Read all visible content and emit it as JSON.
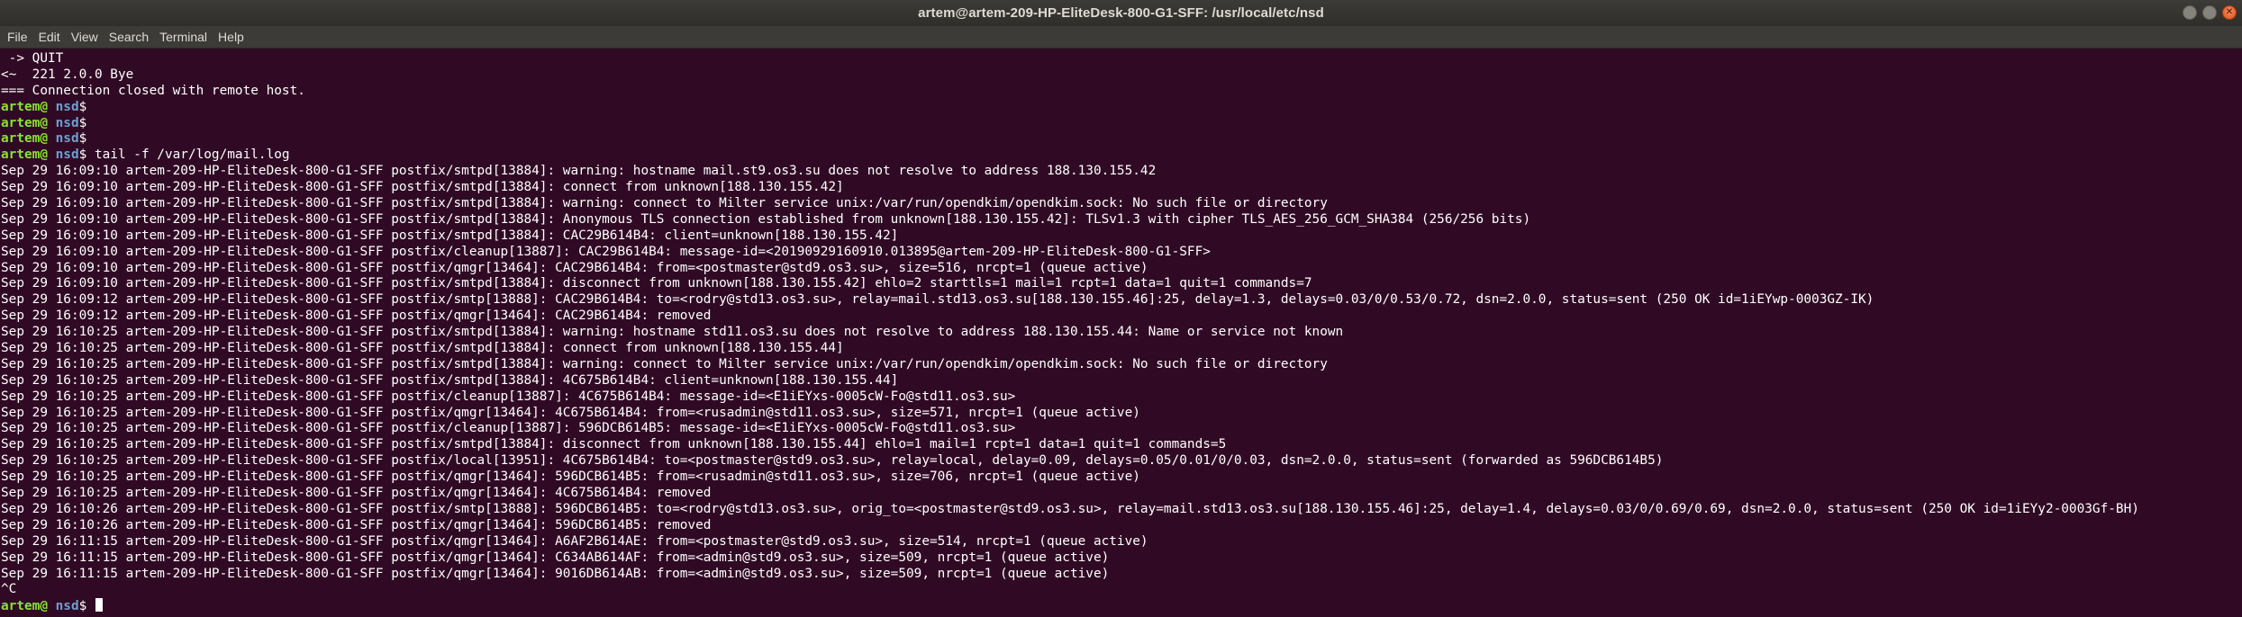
{
  "window": {
    "title": "artem@artem-209-HP-EliteDesk-800-G1-SFF: /usr/local/etc/nsd",
    "controls": {
      "minimize_glyph": "",
      "maximize_glyph": "",
      "close_glyph": "✕"
    }
  },
  "menu": [
    "File",
    "Edit",
    "View",
    "Search",
    "Terminal",
    "Help"
  ],
  "prompt": {
    "user": "artem@",
    "path": " nsd",
    "symbol": "$"
  },
  "colors": {
    "background": "#300a24",
    "prompt_user": "#8ae234",
    "prompt_path": "#729fcf",
    "text": "#ffffff"
  },
  "terminal": {
    "pre_lines": [
      " -> QUIT",
      "<~  221 2.0.0 Bye",
      "=== Connection closed with remote host."
    ],
    "prompt_commands": [
      "",
      "",
      "",
      " tail -f /var/log/mail.log"
    ],
    "log_lines": [
      "Sep 29 16:09:10 artem-209-HP-EliteDesk-800-G1-SFF postfix/smtpd[13884]: warning: hostname mail.st9.os3.su does not resolve to address 188.130.155.42",
      "Sep 29 16:09:10 artem-209-HP-EliteDesk-800-G1-SFF postfix/smtpd[13884]: connect from unknown[188.130.155.42]",
      "Sep 29 16:09:10 artem-209-HP-EliteDesk-800-G1-SFF postfix/smtpd[13884]: warning: connect to Milter service unix:/var/run/opendkim/opendkim.sock: No such file or directory",
      "Sep 29 16:09:10 artem-209-HP-EliteDesk-800-G1-SFF postfix/smtpd[13884]: Anonymous TLS connection established from unknown[188.130.155.42]: TLSv1.3 with cipher TLS_AES_256_GCM_SHA384 (256/256 bits)",
      "Sep 29 16:09:10 artem-209-HP-EliteDesk-800-G1-SFF postfix/smtpd[13884]: CAC29B614B4: client=unknown[188.130.155.42]",
      "Sep 29 16:09:10 artem-209-HP-EliteDesk-800-G1-SFF postfix/cleanup[13887]: CAC29B614B4: message-id=<20190929160910.013895@artem-209-HP-EliteDesk-800-G1-SFF>",
      "Sep 29 16:09:10 artem-209-HP-EliteDesk-800-G1-SFF postfix/qmgr[13464]: CAC29B614B4: from=<postmaster@std9.os3.su>, size=516, nrcpt=1 (queue active)",
      "Sep 29 16:09:10 artem-209-HP-EliteDesk-800-G1-SFF postfix/smtpd[13884]: disconnect from unknown[188.130.155.42] ehlo=2 starttls=1 mail=1 rcpt=1 data=1 quit=1 commands=7",
      "Sep 29 16:09:12 artem-209-HP-EliteDesk-800-G1-SFF postfix/smtp[13888]: CAC29B614B4: to=<rodry@std13.os3.su>, relay=mail.std13.os3.su[188.130.155.46]:25, delay=1.3, delays=0.03/0/0.53/0.72, dsn=2.0.0, status=sent (250 OK id=1iEYwp-0003GZ-IK)",
      "Sep 29 16:09:12 artem-209-HP-EliteDesk-800-G1-SFF postfix/qmgr[13464]: CAC29B614B4: removed",
      "Sep 29 16:10:25 artem-209-HP-EliteDesk-800-G1-SFF postfix/smtpd[13884]: warning: hostname std11.os3.su does not resolve to address 188.130.155.44: Name or service not known",
      "Sep 29 16:10:25 artem-209-HP-EliteDesk-800-G1-SFF postfix/smtpd[13884]: connect from unknown[188.130.155.44]",
      "Sep 29 16:10:25 artem-209-HP-EliteDesk-800-G1-SFF postfix/smtpd[13884]: warning: connect to Milter service unix:/var/run/opendkim/opendkim.sock: No such file or directory",
      "Sep 29 16:10:25 artem-209-HP-EliteDesk-800-G1-SFF postfix/smtpd[13884]: 4C675B614B4: client=unknown[188.130.155.44]",
      "Sep 29 16:10:25 artem-209-HP-EliteDesk-800-G1-SFF postfix/cleanup[13887]: 4C675B614B4: message-id=<E1iEYxs-0005cW-Fo@std11.os3.su>",
      "Sep 29 16:10:25 artem-209-HP-EliteDesk-800-G1-SFF postfix/qmgr[13464]: 4C675B614B4: from=<rusadmin@std11.os3.su>, size=571, nrcpt=1 (queue active)",
      "Sep 29 16:10:25 artem-209-HP-EliteDesk-800-G1-SFF postfix/cleanup[13887]: 596DCB614B5: message-id=<E1iEYxs-0005cW-Fo@std11.os3.su>",
      "Sep 29 16:10:25 artem-209-HP-EliteDesk-800-G1-SFF postfix/smtpd[13884]: disconnect from unknown[188.130.155.44] ehlo=1 mail=1 rcpt=1 data=1 quit=1 commands=5",
      "Sep 29 16:10:25 artem-209-HP-EliteDesk-800-G1-SFF postfix/local[13951]: 4C675B614B4: to=<postmaster@std9.os3.su>, relay=local, delay=0.09, delays=0.05/0.01/0/0.03, dsn=2.0.0, status=sent (forwarded as 596DCB614B5)",
      "Sep 29 16:10:25 artem-209-HP-EliteDesk-800-G1-SFF postfix/qmgr[13464]: 596DCB614B5: from=<rusadmin@std11.os3.su>, size=706, nrcpt=1 (queue active)",
      "Sep 29 16:10:25 artem-209-HP-EliteDesk-800-G1-SFF postfix/qmgr[13464]: 4C675B614B4: removed",
      "Sep 29 16:10:26 artem-209-HP-EliteDesk-800-G1-SFF postfix/smtp[13888]: 596DCB614B5: to=<rodry@std13.os3.su>, orig_to=<postmaster@std9.os3.su>, relay=mail.std13.os3.su[188.130.155.46]:25, delay=1.4, delays=0.03/0/0.69/0.69, dsn=2.0.0, status=sent (250 OK id=1iEYy2-0003Gf-BH)",
      "Sep 29 16:10:26 artem-209-HP-EliteDesk-800-G1-SFF postfix/qmgr[13464]: 596DCB614B5: removed",
      "Sep 29 16:11:15 artem-209-HP-EliteDesk-800-G1-SFF postfix/qmgr[13464]: A6AF2B614AE: from=<postmaster@std9.os3.su>, size=514, nrcpt=1 (queue active)",
      "Sep 29 16:11:15 artem-209-HP-EliteDesk-800-G1-SFF postfix/qmgr[13464]: C634AB614AF: from=<admin@std9.os3.su>, size=509, nrcpt=1 (queue active)",
      "Sep 29 16:11:15 artem-209-HP-EliteDesk-800-G1-SFF postfix/qmgr[13464]: 9016DB614AB: from=<admin@std9.os3.su>, size=509, nrcpt=1 (queue active)"
    ],
    "interrupt_line": "^C",
    "final_prompt_command": " "
  }
}
